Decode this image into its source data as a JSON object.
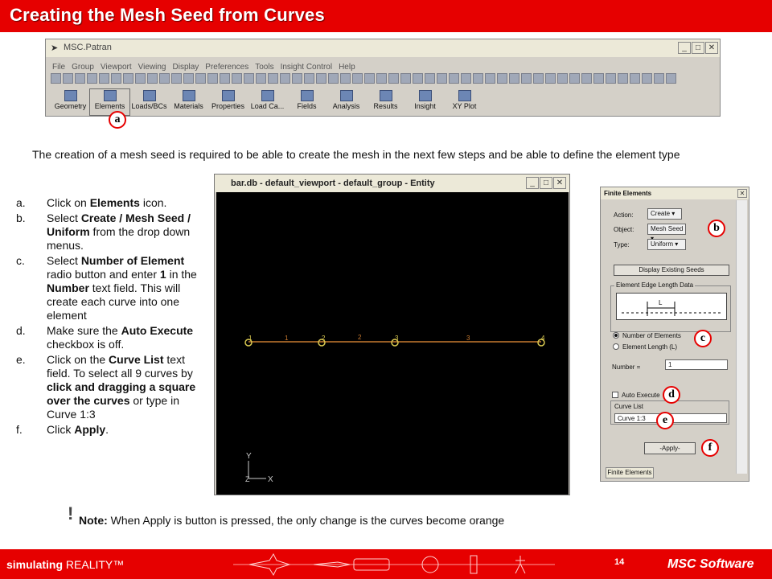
{
  "slide": {
    "title": "Creating the Mesh Seed from Curves",
    "page_number": "14"
  },
  "patran": {
    "title": "MSC.Patran",
    "menu": [
      "File",
      "Group",
      "Viewport",
      "Viewing",
      "Display",
      "Preferences",
      "Tools",
      "Insight Control",
      "Help"
    ],
    "apps": [
      "Geometry",
      "Elements",
      "Loads/BCs",
      "Materials",
      "Properties",
      "Load Ca...",
      "Fields",
      "Analysis",
      "Results",
      "Insight",
      "XY Plot"
    ]
  },
  "markers": {
    "a": "a",
    "b": "b",
    "c": "c",
    "d": "d",
    "e": "e",
    "f": "f"
  },
  "intro": "The creation of a mesh seed is required to be able to create the mesh in the next few steps and be able to define the element type",
  "steps": [
    {
      "label": "a.",
      "parts": [
        {
          "t": "Click on "
        },
        {
          "b": "Elements"
        },
        {
          "t": " icon."
        }
      ]
    },
    {
      "label": "b.",
      "parts": [
        {
          "t": "Select "
        },
        {
          "b": "Create / Mesh Seed / Uniform"
        },
        {
          "t": " from the drop down menus."
        }
      ]
    },
    {
      "label": "c.",
      "parts": [
        {
          "t": "Select "
        },
        {
          "b": "Number of Element"
        },
        {
          "t": " radio button and enter "
        },
        {
          "b": "1"
        },
        {
          "t": " in the "
        },
        {
          "b": "Number"
        },
        {
          "t": " text field. This will create each curve into one element"
        }
      ]
    },
    {
      "label": "d.",
      "parts": [
        {
          "t": "Make sure the "
        },
        {
          "b": "Auto Execute"
        },
        {
          "t": " checkbox is off."
        }
      ]
    },
    {
      "label": "e.",
      "parts": [
        {
          "t": "Click on the "
        },
        {
          "b": "Curve List"
        },
        {
          "t": " text field. To select all 9 curves by "
        },
        {
          "b": "click and dragging a square over the curves"
        },
        {
          "t": " or type in Curve 1:3"
        }
      ]
    },
    {
      "label": "f.",
      "parts": [
        {
          "t": "Click "
        },
        {
          "b": "Apply"
        },
        {
          "t": "."
        }
      ]
    }
  ],
  "viewport": {
    "title": "bar.db - default_viewport - default_group - Entity",
    "node_labels": [
      "1",
      "2",
      "3",
      "4"
    ],
    "curve_labels": [
      "1",
      "2",
      "3"
    ],
    "axis_x": "X",
    "axis_y": "Y",
    "axis_z": "Z"
  },
  "fe_form": {
    "title": "Finite Elements",
    "action_label": "Action:",
    "action_value": "Create",
    "object_label": "Object:",
    "object_value": "Mesh Seed",
    "type_label": "Type:",
    "type_value": "Uniform",
    "display_seeds": "Display Existing Seeds",
    "edge_group": "Element Edge Length Data",
    "edge_l": "L",
    "radio_num": "Number of Elements",
    "radio_len": "Element Length (L)",
    "number_label": "Number =",
    "number_value": "1",
    "auto_execute": "Auto Execute",
    "curve_list_label": "Curve List",
    "curve_list_value": "Curve 1:3",
    "apply": "-Apply-",
    "tab": "Finite Elements"
  },
  "note": {
    "bold": "Note:",
    "text": " When Apply is button is pressed, the only change is the curves become orange"
  },
  "footer": {
    "tagline_bold": "simulating",
    "tagline_rest": " REALITY™",
    "brand": "MSC Software"
  },
  "colors": {
    "accent": "#e60000",
    "curve": "#c87a30",
    "node": "#d8c850"
  }
}
